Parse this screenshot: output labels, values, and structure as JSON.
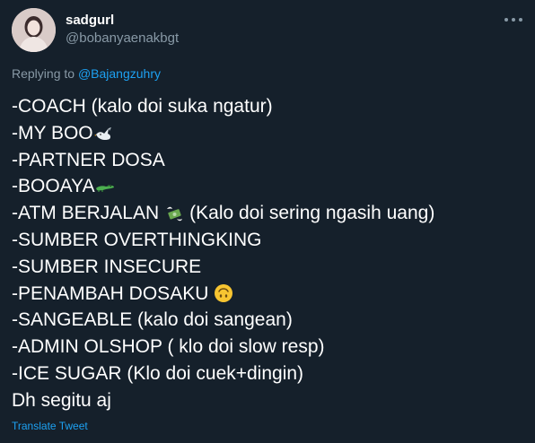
{
  "user": {
    "display_name": "sadgurl",
    "handle": "@bobanyaenakbgt"
  },
  "reply": {
    "prefix": "Replying to",
    "mention": "@Bajangzuhry"
  },
  "tweet_lines": [
    {
      "text": "-COACH (kalo doi suka ngatur)"
    },
    {
      "text": "-MY BOO",
      "emoji": "dove-emoji"
    },
    {
      "text": "-PARTNER DOSA"
    },
    {
      "text": "-BOOAYA",
      "emoji": "crocodile-emoji"
    },
    {
      "text": "-ATM BERJALAN",
      "emoji": "money-wings-emoji",
      "after": "(Kalo doi sering ngasih uang)"
    },
    {
      "text": "-SUMBER OVERTHINGKING"
    },
    {
      "text": "-SUMBER INSECURE"
    },
    {
      "text": "-PENAMBAH DOSAKU",
      "emoji": "upside-down-face-emoji"
    },
    {
      "text": "-SANGEABLE (kalo doi sangean)"
    },
    {
      "text": "-ADMIN OLSHOP ( klo doi slow resp)"
    },
    {
      "text": "-ICE SUGAR (Klo doi cuek+dingin)"
    },
    {
      "text": "Dh segitu aj"
    }
  ],
  "translate_label": "Translate Tweet",
  "colors": {
    "background": "#15202b",
    "secondary_text": "#8899a6",
    "link": "#1da1f2",
    "primary_text": "#ffffff"
  }
}
